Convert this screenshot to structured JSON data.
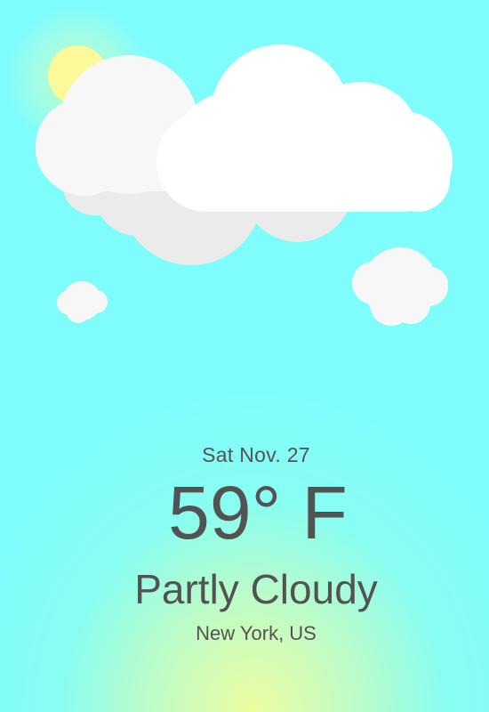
{
  "weather": {
    "date": "Sat Nov. 27",
    "temperature": "59° F",
    "condition": "Partly Cloudy",
    "location": "New York, US"
  },
  "colors": {
    "sky": "#7ffdfd",
    "sun": "#fbfa9a",
    "text": "#535353",
    "cloud_front": "#ffffff",
    "cloud_back": "#f7f7f7",
    "cloud_shadow": "#ebebeb"
  },
  "icons": [
    "sun-icon",
    "cloud-icon"
  ]
}
